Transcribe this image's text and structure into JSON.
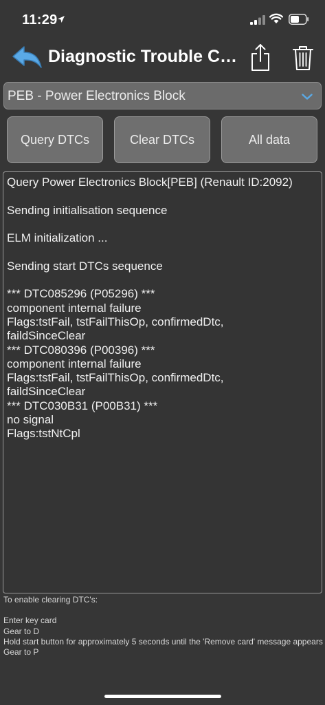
{
  "status_bar": {
    "time": "11:29"
  },
  "nav": {
    "title": "Diagnostic Trouble Co..."
  },
  "ecu_select": {
    "value": "PEB - Power Electronics Block"
  },
  "buttons": {
    "query": "Query DTCs",
    "clear": "Clear DTCs",
    "all": "All data"
  },
  "log": {
    "lines": [
      "Query Power Electronics Block[PEB] (Renault ID:2092)",
      "",
      "Sending initialisation sequence",
      "",
      "ELM initialization ...",
      "",
      "Sending start DTCs sequence",
      "",
      "*** DTC085296 (P05296) ***",
      "component internal failure",
      "Flags:tstFail, tstFailThisOp, confirmedDtc,",
      "faildSinceClear",
      "*** DTC080396 (P00396) ***",
      "component internal failure",
      "Flags:tstFail, tstFailThisOp, confirmedDtc,",
      "faildSinceClear",
      "*** DTC030B31 (P00B31) ***",
      "no signal",
      "Flags:tstNtCpl"
    ]
  },
  "info": {
    "lines": [
      "To enable clearing DTC's:",
      "",
      "Enter key card",
      "Gear to D",
      "Hold start button for approximately 5 seconds until the 'Remove card' message appears",
      "Gear to P"
    ]
  },
  "colors": {
    "accent": "#5aa9e6",
    "background": "#363636",
    "button": "#6f6f6f"
  }
}
